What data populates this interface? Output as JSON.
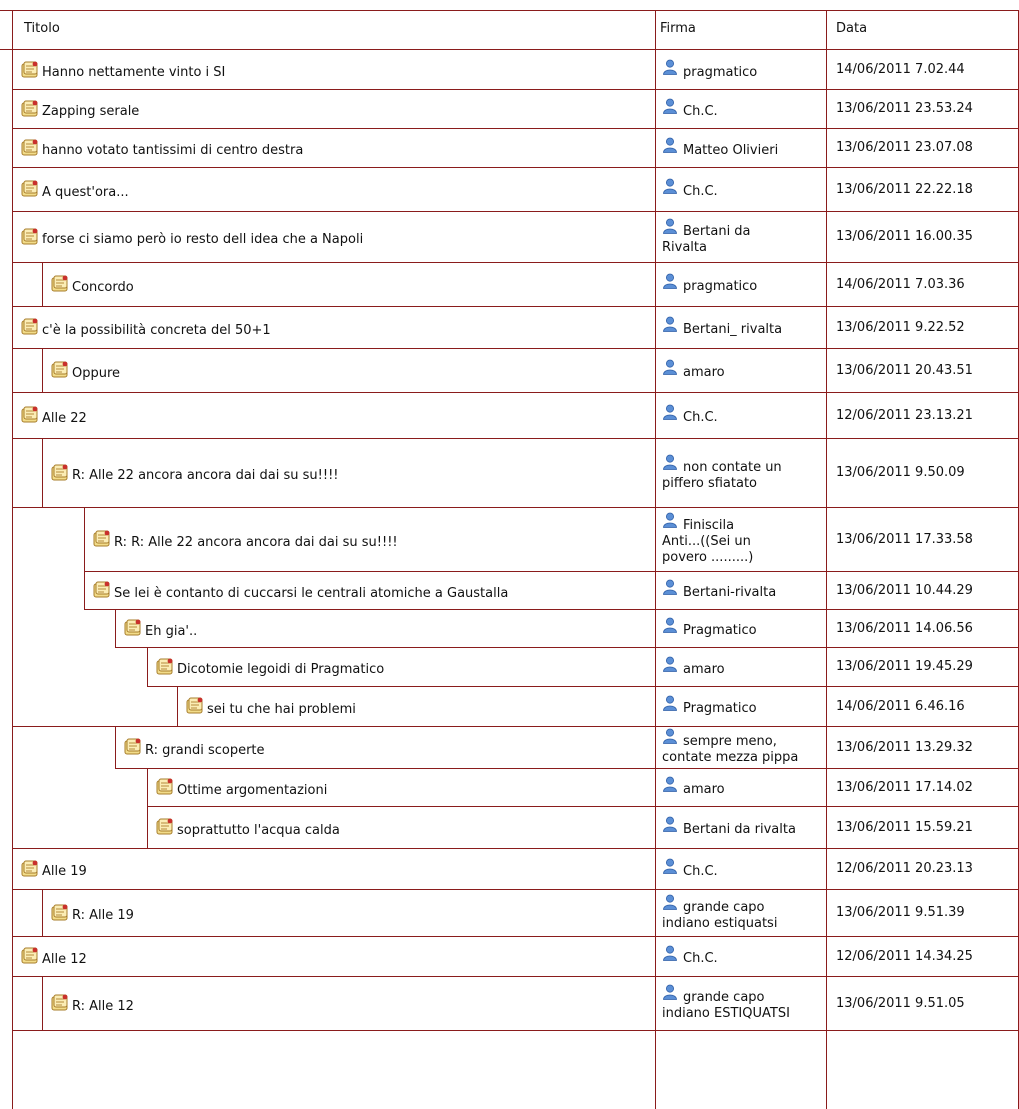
{
  "header": {
    "titolo": "Titolo",
    "firma": "Firma",
    "data": "Data"
  },
  "posts": [
    {
      "title": "Hanno nettamente vinto i SI",
      "author": [
        "pragmatico"
      ],
      "date": "14/06/2011 7.02.44"
    },
    {
      "title": "Zapping serale",
      "author": [
        "Ch.C."
      ],
      "date": "13/06/2011 23.53.24"
    },
    {
      "title": "hanno votato tantissimi di centro destra",
      "author": [
        "Matteo Olivieri"
      ],
      "date": "13/06/2011 23.07.08"
    },
    {
      "title": "A quest'ora...",
      "author": [
        "Ch.C."
      ],
      "date": "13/06/2011 22.22.18"
    },
    {
      "title": "forse ci siamo però io resto dell idea che a Napoli",
      "author": [
        "Bertani da",
        "Rivalta"
      ],
      "date": "13/06/2011 16.00.35"
    },
    {
      "title": "Concordo",
      "author": [
        "pragmatico"
      ],
      "date": "14/06/2011 7.03.36"
    },
    {
      "title": "c'è la possibilità concreta del 50+1",
      "author": [
        "Bertani_ rivalta"
      ],
      "date": "13/06/2011 9.22.52"
    },
    {
      "title": "Oppure",
      "author": [
        "amaro"
      ],
      "date": "13/06/2011 20.43.51"
    },
    {
      "title": "Alle 22",
      "author": [
        "Ch.C."
      ],
      "date": "12/06/2011 23.13.21"
    },
    {
      "title": "R: Alle 22 ancora ancora dai dai su su!!!!",
      "author": [
        "non contate un",
        "piffero sfiatato"
      ],
      "date": "13/06/2011 9.50.09"
    },
    {
      "title": "R: R: Alle 22 ancora ancora dai dai su su!!!!",
      "author": [
        "Finiscila",
        "Anti...((Sei un",
        "povero .........)"
      ],
      "date": "13/06/2011 17.33.58"
    },
    {
      "title": "Se lei è contanto di cuccarsi le centrali atomiche a Gaustalla",
      "author": [
        "Bertani-rivalta"
      ],
      "date": "13/06/2011 10.44.29"
    },
    {
      "title": "Eh gia'..",
      "author": [
        "Pragmatico"
      ],
      "date": "13/06/2011 14.06.56"
    },
    {
      "title": "Dicotomie legoidi di Pragmatico",
      "author": [
        "amaro"
      ],
      "date": "13/06/2011 19.45.29"
    },
    {
      "title": "sei tu che hai problemi",
      "author": [
        "Pragmatico"
      ],
      "date": "14/06/2011 6.46.16"
    },
    {
      "title": "R: grandi scoperte",
      "author": [
        "sempre meno,",
        "contate mezza pippa"
      ],
      "date": "13/06/2011 13.29.32"
    },
    {
      "title": "Ottime argomentazioni",
      "author": [
        "amaro"
      ],
      "date": "13/06/2011 17.14.02"
    },
    {
      "title": "soprattutto l'acqua calda",
      "author": [
        "Bertani da rivalta"
      ],
      "date": "13/06/2011 15.59.21"
    },
    {
      "title": "Alle 19",
      "author": [
        "Ch.C."
      ],
      "date": "12/06/2011 20.23.13"
    },
    {
      "title": "R: Alle 19",
      "author": [
        "grande capo",
        "indiano estiquatsi"
      ],
      "date": "13/06/2011 9.51.39"
    },
    {
      "title": "Alle 12",
      "author": [
        "Ch.C."
      ],
      "date": "12/06/2011 14.34.25"
    },
    {
      "title": "R: Alle 12",
      "author": [
        "grande capo",
        "indiano ESTIQUATSI"
      ],
      "date": "13/06/2011 9.51.05"
    }
  ],
  "colors": {
    "border": "#8a1c1c",
    "text": "#111111",
    "avatar": "#5b8fd6"
  }
}
